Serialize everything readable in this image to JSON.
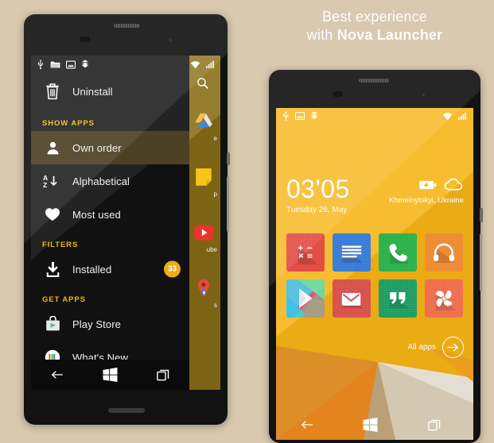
{
  "background_color": "#d9c9ae",
  "headline": {
    "line1": "Best experience",
    "line2_prefix": "with ",
    "line2_brand": "Nova Launcher"
  },
  "left_phone": {
    "status_bar": {
      "left_icons": [
        "usb-icon",
        "folder-icon",
        "screenshot-icon",
        "debug-bug-icon"
      ],
      "right_icons": [
        "wifi-icon",
        "signal-icon"
      ]
    },
    "drawer_behind": {
      "search_icon": "search-icon",
      "apps": [
        {
          "name": "drive-icon",
          "label": "e"
        },
        {
          "name": "keep-icon",
          "label": "p"
        },
        {
          "name": "youtube-icon",
          "label": "ube"
        },
        {
          "name": "maps-icon",
          "label": "s"
        }
      ]
    },
    "menu": {
      "top_action": {
        "label": "Uninstall",
        "icon": "trash-icon"
      },
      "sections": [
        {
          "title": "SHOW APPS",
          "items": [
            {
              "label": "Own order",
              "icon": "person-icon",
              "selected": true,
              "badge": ""
            },
            {
              "label": "Alphabetical",
              "icon": "sort-az-icon",
              "selected": false,
              "badge": ""
            },
            {
              "label": "Most used",
              "icon": "heart-icon",
              "selected": false,
              "badge": ""
            }
          ]
        },
        {
          "title": "FILTERS",
          "items": [
            {
              "label": "Installed",
              "icon": "download-icon",
              "selected": false,
              "badge": "33"
            }
          ]
        },
        {
          "title": "GET APPS",
          "items": [
            {
              "label": "Play Store",
              "icon": "play-store-bag-icon",
              "selected": false,
              "badge": ""
            },
            {
              "label": "What's New",
              "icon": "whats-new-icon",
              "selected": false,
              "badge": ""
            }
          ]
        }
      ],
      "selected_highlight_color": "#4d4124",
      "section_title_color": "#f2b705",
      "badge_color": "#f0ab18"
    },
    "nav_bar": {
      "back": "back-arrow-icon",
      "home": "windows-home-icon",
      "recents": "recents-square-icon"
    }
  },
  "right_phone": {
    "status_bar": {
      "left_icons": [
        "usb-icon",
        "screenshot-icon",
        "debug-bug-icon"
      ],
      "right_icons": [
        "wifi-icon",
        "signal-icon"
      ]
    },
    "clock": "03'05",
    "date": "Tuesday 26, May",
    "location": "Khmelnytskyi, Ukraine",
    "weather_icons": [
      "battery-charging-icon",
      "cloud-icon"
    ],
    "apps": [
      {
        "name": "calculator-icon",
        "color": "#e14b42"
      },
      {
        "name": "messages-icon",
        "color": "#3a7bd5"
      },
      {
        "name": "phone-icon",
        "color": "#2bb24c"
      },
      {
        "name": "music-headphones-icon",
        "color": "#ef8b33"
      },
      {
        "name": "play-store-icon",
        "color": "#59c3e0"
      },
      {
        "name": "email-icon",
        "color": "#d8514b"
      },
      {
        "name": "hangouts-icon",
        "color": "#1f9d63"
      },
      {
        "name": "pinwheel-icon",
        "color": "#ef6e4e"
      }
    ],
    "all_apps_label": "All apps",
    "all_apps_icon": "arrow-right-circle-icon",
    "accent_color": "#f6b415",
    "nav_bar": {
      "back": "back-arrow-icon",
      "home": "windows-home-icon",
      "recents": "recents-square-icon"
    }
  }
}
